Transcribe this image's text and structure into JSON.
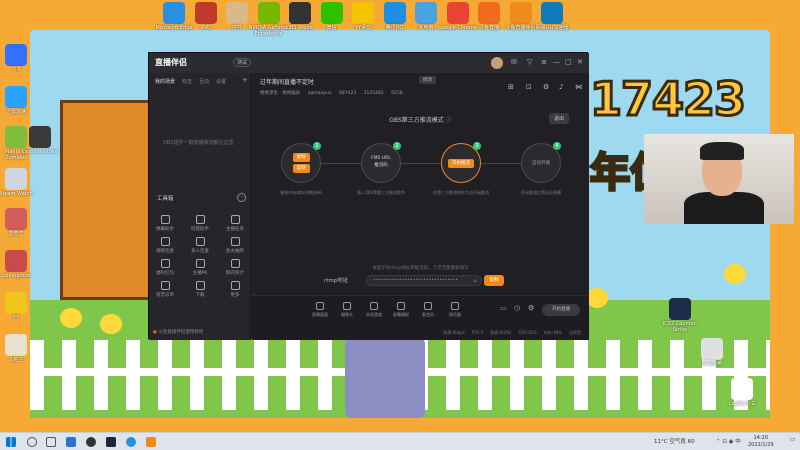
{
  "desktop": {
    "top_icons": [
      {
        "label": "Microsoft Edge",
        "color": "#2b8fe0"
      },
      {
        "label": "炉石",
        "color": "#c0392b"
      },
      {
        "label": "控件",
        "color": "#d9b98a"
      },
      {
        "label": "NVIDIA GeForce Experience",
        "color": "#76b900"
      },
      {
        "label": "OBS Studio",
        "color": "#333333"
      },
      {
        "label": "微信",
        "color": "#2dc100"
      },
      {
        "label": "YY语音",
        "color": "#f5c400"
      },
      {
        "label": "腾讯QQ",
        "color": "#1e8fe3"
      },
      {
        "label": "此电脑",
        "color": "#4aa3df"
      },
      {
        "label": "Google Chrome",
        "color": "#ea4335"
      },
      {
        "label": "斗鱼直播",
        "color": "#f26a1b"
      },
      {
        "label": "斗鱼直播伴侣",
        "color": "#f08a1b"
      },
      {
        "label": "网易UU加速器",
        "color": "#0f7bb8"
      }
    ],
    "left_icons": [
      {
        "label": "飞书",
        "color": "#3370ff"
      },
      {
        "label": "迅雷加速",
        "color": "#2aa0ff"
      },
      {
        "label": "Plants vs Zombies",
        "color": "#7fbd3c"
      },
      {
        "label": "Counter-Strike",
        "color": "#3a3a3a"
      },
      {
        "label": "Steam Watch",
        "color": "#cfd6e0"
      },
      {
        "label": "爱奇艺",
        "color": "#d35c5c"
      },
      {
        "label": "LolKingdom",
        "color": "#c94a4a"
      },
      {
        "label": "YY",
        "color": "#f2c51c"
      },
      {
        "label": "斗地主",
        "color": "#e9e2d0"
      }
    ],
    "right_icons": [
      {
        "label": "ICS2 Counter-Strike",
        "color": "#1d2b4a"
      },
      {
        "label": "反恐精英",
        "color": "#e0e0e0"
      },
      {
        "label": "Logitech G",
        "color": "#ffffff"
      }
    ],
    "wallpaper_text": "17423",
    "wallpaper_text2": "年位"
  },
  "app": {
    "logo": "直播伴侣",
    "logo_badge": "测试",
    "sidebar": {
      "tabs": [
        "我的场景",
        "双击",
        "互动",
        "设置"
      ],
      "empty_text": "OBS插件一键收播推流都在这里",
      "tools_heading": "工具箱",
      "tools": [
        "弹幕助手",
        "房管助手",
        "主播任务",
        "视频连麦",
        "多人连麦",
        "鱼丸抽奖",
        "福利红包",
        "主播PK",
        "鲜花统计",
        "语音派单",
        "下载",
        "更多"
      ],
      "footer": "斗鱼直播伴侣使用教程"
    },
    "room": {
      "title": "过年期间直播不定时",
      "edit_button": "修改",
      "category": "绝地求生 · 休闲娱乐",
      "name": "ygmaopuo",
      "id": "687423",
      "heat": "1125482",
      "fans": "9258"
    },
    "mode": {
      "title": "OBS第三方推流模式",
      "exit_button": "退出",
      "steps": [
        {
          "num": "1",
          "line1": "复制",
          "line2": "复制",
          "desc": "复制rtmp地址和推流码"
        },
        {
          "num": "2",
          "line1": "FMS URL",
          "line2": "推流码",
          "desc": "填入OBS等第三方推流软件"
        },
        {
          "num": "3",
          "line1": "开始推流",
          "line2": "",
          "desc": "在第三方推流软件点击开始推流"
        },
        {
          "num": "4",
          "line1": "自动开播",
          "line2": "",
          "desc": "开启推流后将自动直播"
        }
      ],
      "rtmp_label": "rtmp地址",
      "rtmp_value": "••••••••••••••••••••••••••••••••",
      "key_label": "推流码",
      "key_value": "••••••••••••••••••••••••",
      "copy_label": "复制",
      "hint": "本提示为rtmp地址和推流码，下次无需重新填写"
    },
    "bottom_bar": [
      "直播画面",
      "摄像头",
      "本机游戏",
      "屏幕捕捉",
      "麦克风",
      "扬声器"
    ],
    "start_button": "开始直播",
    "stats": [
      "码率:0kbps",
      "FPS:0",
      "丢帧:0(0%)",
      "CPU:16%",
      "内存:48%",
      "出声音"
    ]
  },
  "taskbar": {
    "weather": "11°C 空气良 60",
    "time": "14:20",
    "date": "2022/1/29"
  }
}
